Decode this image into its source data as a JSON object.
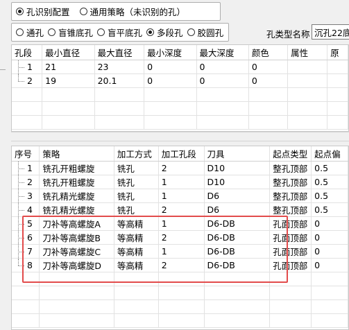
{
  "mode": {
    "options": [
      {
        "label": "孔识别配置",
        "selected": true
      },
      {
        "label": "通用策略（未识别的孔）",
        "selected": false
      }
    ]
  },
  "hole_type": {
    "options": [
      {
        "label": "通孔",
        "selected": false
      },
      {
        "label": "盲锥底孔",
        "selected": false
      },
      {
        "label": "盲平底孔",
        "selected": false
      },
      {
        "label": "多段孔",
        "selected": true
      },
      {
        "label": "胶圆孔",
        "selected": false
      }
    ],
    "name_label": "孔类型名称",
    "name_value": "沉孔22底"
  },
  "segments": {
    "columns": [
      "孔段",
      "最小直径",
      "最大直径",
      "最小深度",
      "最大深度",
      "颜色",
      "属性",
      "原"
    ],
    "rows": [
      [
        "1",
        "21",
        "23",
        "0",
        "0",
        "0",
        "",
        ""
      ],
      [
        "2",
        "19",
        "20.1",
        "0",
        "0",
        "0",
        "",
        ""
      ]
    ]
  },
  "strategies": {
    "columns": [
      "序号",
      "策略",
      "加工方式",
      "加工孔段",
      "刀具",
      "起点类型",
      "起点偏"
    ],
    "rows": [
      [
        "1",
        "铣孔开粗螺旋",
        "铣孔",
        "2",
        "D10",
        "整孔顶部",
        "0.5"
      ],
      [
        "2",
        "铣孔开粗螺旋",
        "铣孔",
        "1",
        "D10",
        "整孔顶部",
        "0.5"
      ],
      [
        "3",
        "铣孔精光螺旋",
        "铣孔",
        "1",
        "D6",
        "整孔顶部",
        "0.5"
      ],
      [
        "4",
        "铣孔精光螺旋",
        "铣孔",
        "2",
        "D6",
        "整孔顶部",
        "0.5"
      ],
      [
        "5",
        "刀补等高螺旋A",
        "等高精",
        "1",
        "D6-DB",
        "孔面顶部",
        "0"
      ],
      [
        "6",
        "刀补等高螺旋B",
        "等高精",
        "2",
        "D6-DB",
        "孔面顶部",
        "0"
      ],
      [
        "7",
        "刀补等高螺旋C",
        "等高精",
        "1",
        "D6-DB",
        "孔面顶部",
        "0"
      ],
      [
        "8",
        "刀补等高螺旋D",
        "等高精",
        "2",
        "D6-DB",
        "孔面顶部",
        "0"
      ]
    ]
  },
  "colors": {
    "highlight": "#e24b4b",
    "border": "#adadad"
  }
}
